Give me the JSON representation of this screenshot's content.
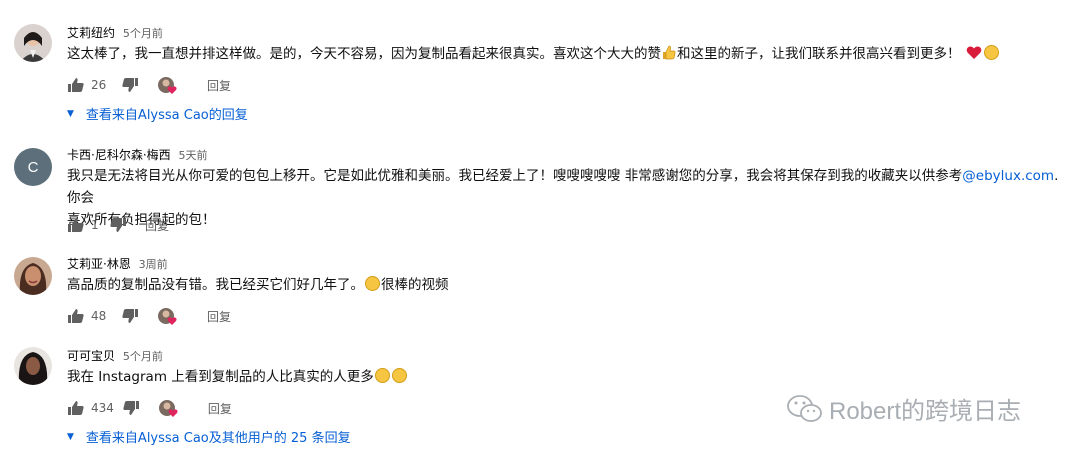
{
  "comments": [
    {
      "author": "艾莉纽约",
      "time": "5个月前",
      "text_a": "这太棒了，我一直想并排这样做。是的，今天不容易，因为复制品看起来很真实。喜欢这个大大的赞",
      "text_b": "和这里的新子，让我们联系并很高兴看到更多！",
      "likes": "26",
      "reply_label": "回复",
      "view_replies": "查看来自Alyssa Cao的回复"
    },
    {
      "author": "卡西·尼科尔森·梅西",
      "time": "5天前",
      "avatar_letter": "C",
      "text_a": "我只是无法将目光从你可爱的包包上移开。它是如此优雅和美丽。我已经爱上了！嗖嗖嗖嗖嗖 非常感谢您的分享，我会将其保存到我的收藏夹以供参考",
      "link": "@ebylux.com",
      "text_b": ". 你会",
      "text_c": "喜欢所有负担得起的包！",
      "likes": "1",
      "reply_label": "回复"
    },
    {
      "author": "艾莉亚·林恩",
      "time": "3周前",
      "text_a": "高品质的复制品没有错。我已经买它们好几年了。",
      "text_b": "很棒的视频",
      "likes": "48",
      "reply_label": "回复"
    },
    {
      "author": "可可宝贝",
      "time": "5个月前",
      "text_a": "我在 Instagram 上看到复制品的人比真实的人更多",
      "likes": "434",
      "reply_label": "回复",
      "view_replies": "查看来自Alyssa Cao及其他用户的 25 条回复"
    }
  ],
  "watermark": "Robert的跨境日志",
  "colors": {
    "link": "#065fd4",
    "meta": "#606060",
    "heart": "#e0245e"
  }
}
